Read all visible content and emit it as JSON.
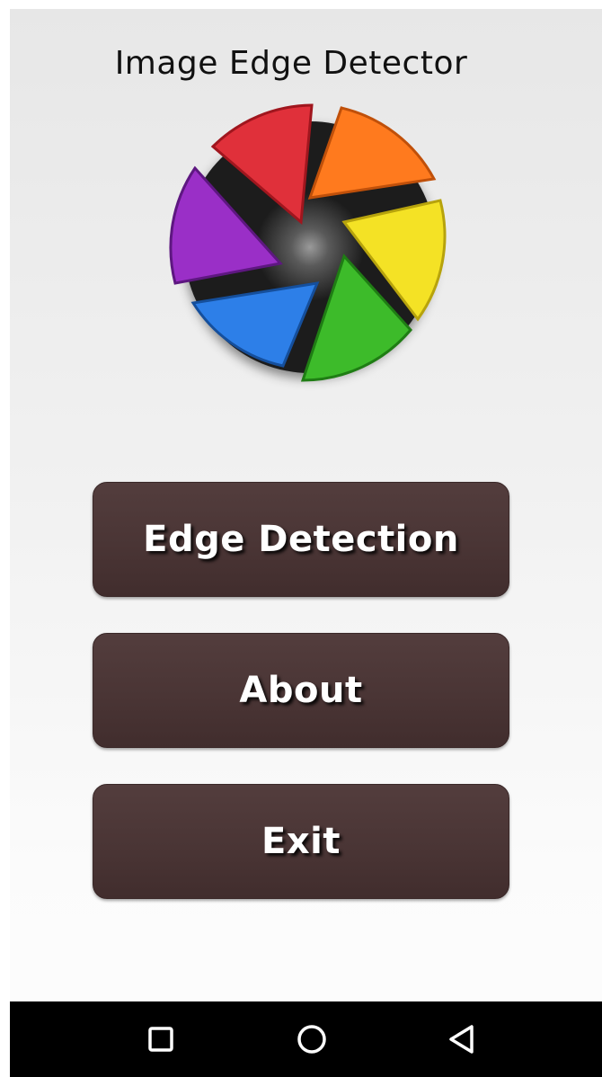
{
  "app": {
    "title": "Image Edge Detector"
  },
  "menu": {
    "edge_detection_label": "Edge Detection",
    "about_label": "About",
    "exit_label": "Exit"
  },
  "navbar": {
    "recents_icon": "square-recents-icon",
    "home_icon": "circle-home-icon",
    "back_icon": "triangle-back-icon"
  },
  "colors": {
    "button_bg": "#4a3535",
    "button_text": "#ffffff",
    "navbar_bg": "#000000",
    "logo_red": "#e0303a",
    "logo_orange": "#ff7a1e",
    "logo_yellow": "#f4e225",
    "logo_green": "#3dbb2a",
    "logo_blue": "#2d7fe8",
    "logo_purple": "#9a2fc7"
  }
}
